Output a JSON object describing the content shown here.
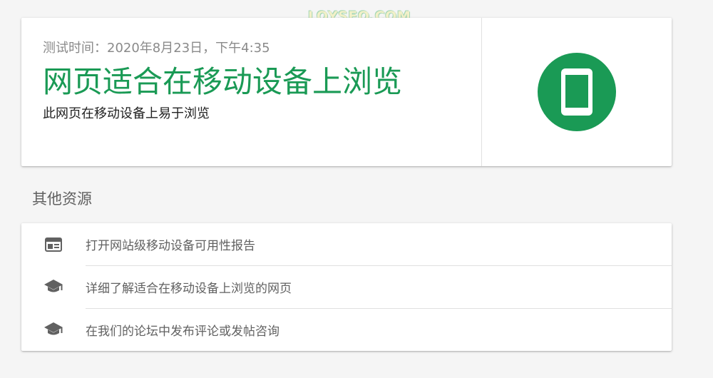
{
  "watermark": "LOYSEO.COM",
  "result": {
    "test_time": "测试时间：2020年8月23日，下午4:35",
    "headline": "网页适合在移动设备上浏览",
    "subtitle": "此网页在移动设备上易于浏览",
    "icon": "mobile-phone-icon",
    "accent_color": "#1a9a55"
  },
  "resources": {
    "heading": "其他资源",
    "items": [
      {
        "label": "打开网站级移动设备可用性报告",
        "icon": "report-icon"
      },
      {
        "label": "详细了解适合在移动设备上浏览的网页",
        "icon": "graduation-cap-icon"
      },
      {
        "label": "在我们的论坛中发布评论或发帖咨询",
        "icon": "graduation-cap-icon"
      }
    ]
  }
}
